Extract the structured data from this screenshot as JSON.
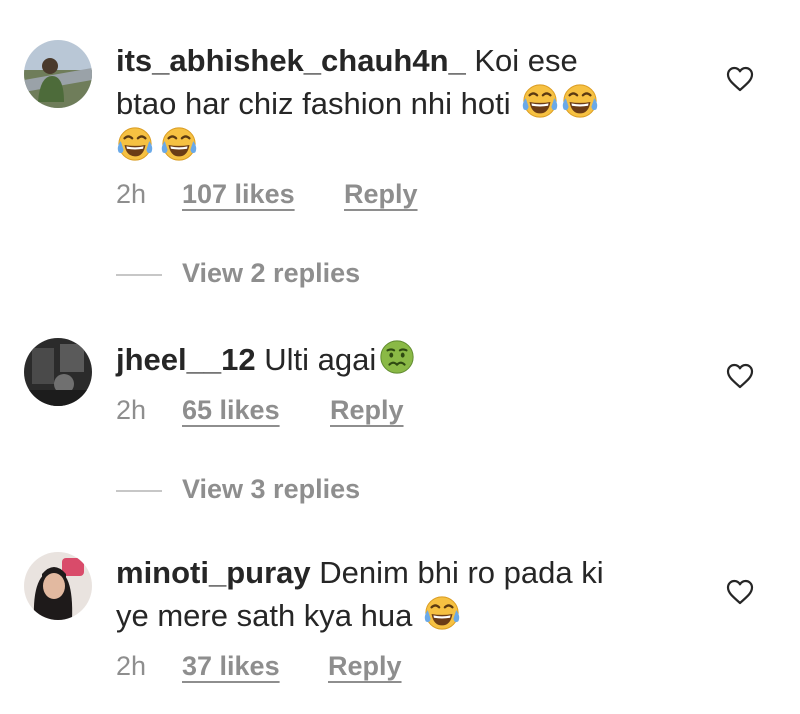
{
  "comments": [
    {
      "username": "its_abhishek_chauh4n_",
      "text_line1": " Koi ese",
      "text_line2": "btao har chiz fashion nhi hoti",
      "time": "2h",
      "likes": "107 likes",
      "reply": "Reply",
      "view_replies": "View 2 replies",
      "emojis": [
        "tears-of-joy",
        "tears-of-joy",
        "tears-of-joy",
        "tears-of-joy"
      ]
    },
    {
      "username": "jheel__12",
      "text_line1": " Ulti agai",
      "time": "2h",
      "likes": "65 likes",
      "reply": "Reply",
      "view_replies": "View 3 replies",
      "emojis": [
        "nauseated-face"
      ]
    },
    {
      "username": "minoti_puray",
      "text_line1": " Denim bhi ro pada ki",
      "text_line2": "ye mere sath kya hua",
      "time": "2h",
      "likes": "37 likes",
      "reply": "Reply",
      "emojis": [
        "tears-of-joy"
      ]
    }
  ],
  "colors": {
    "text": "#262626",
    "muted": "#8e8e8e",
    "emoji_yellow": "#f6c142",
    "emoji_tear": "#6aa9e8",
    "emoji_green": "#8ab946"
  }
}
